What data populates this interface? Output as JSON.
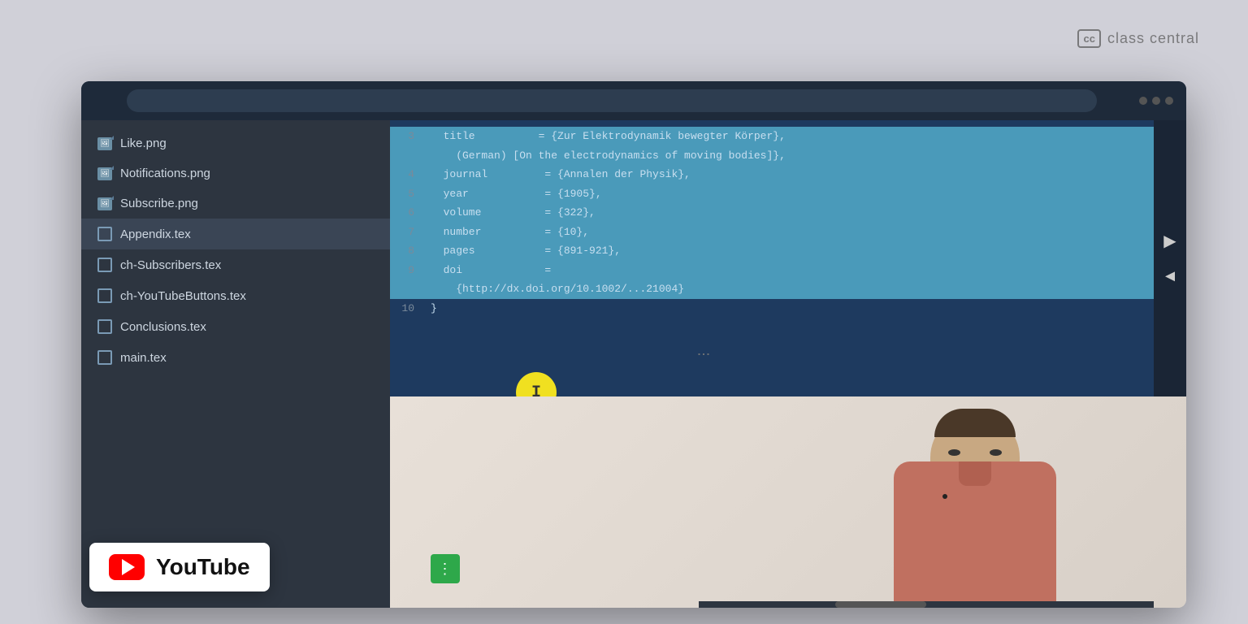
{
  "watermark": {
    "logo": "cc",
    "brand": "class central"
  },
  "browser": {
    "dots": [
      "dot1",
      "dot2",
      "dot3"
    ]
  },
  "sidebar": {
    "files": [
      {
        "name": "Like.png",
        "type": "image",
        "icon": "🖼"
      },
      {
        "name": "Notifications.png",
        "type": "image",
        "icon": "🖼"
      },
      {
        "name": "Subscribe.png",
        "type": "image",
        "icon": "🖼"
      },
      {
        "name": "Appendix.tex",
        "type": "tex",
        "icon": "📄"
      },
      {
        "name": "ch-Subscribers.tex",
        "type": "tex",
        "icon": "📄"
      },
      {
        "name": "ch-YouTubeButtons.tex",
        "type": "tex",
        "icon": "📄"
      },
      {
        "name": "Conclusions.tex",
        "type": "tex",
        "icon": "📄"
      },
      {
        "name": "main.tex",
        "type": "tex",
        "icon": "📄"
      }
    ]
  },
  "code": {
    "lines": [
      {
        "num": "3",
        "content": "  title          = {Zur Elektrodynamik bewegter Körper},",
        "highlight": true
      },
      {
        "num": "",
        "content": "    (German) [On the electrodynamics of moving bodies]},",
        "highlight": true
      },
      {
        "num": "4",
        "content": "  journal         = {Annalen der Physik},",
        "highlight": true
      },
      {
        "num": "5",
        "content": "  year            = {1905},",
        "highlight": true
      },
      {
        "num": "6",
        "content": "  volume          = {322},",
        "highlight": true
      },
      {
        "num": "7",
        "content": "  number          = {10},",
        "highlight": true
      },
      {
        "num": "8",
        "content": "  pages           = {891-921},",
        "highlight": true
      },
      {
        "num": "9",
        "content": "  doi             =",
        "highlight": true
      },
      {
        "num": "",
        "content": "    {http://dx.doi.org/10.1002/...21004}",
        "highlight": true
      },
      {
        "num": "10",
        "content": "}",
        "highlight": false
      }
    ]
  },
  "cursor": {
    "symbol": "I"
  },
  "youtube": {
    "label": "YouTube"
  },
  "nav_arrows": {
    "forward": "→",
    "back": "←"
  }
}
